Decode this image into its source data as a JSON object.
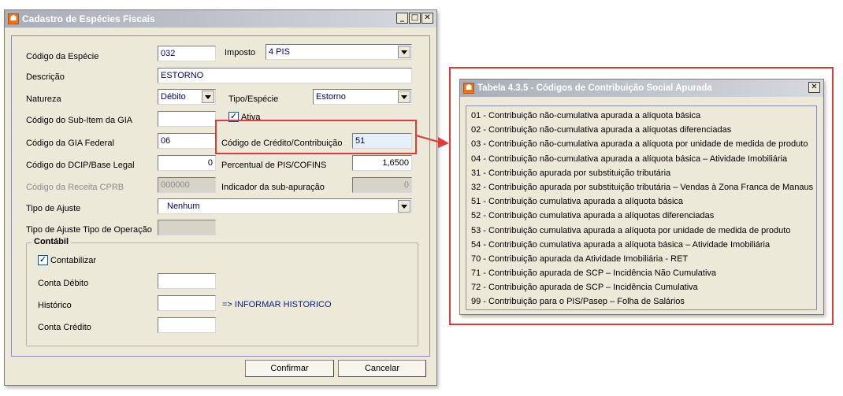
{
  "dialog": {
    "title": "Cadastro de Espécies Fiscais",
    "minimize_glyph": "_",
    "maximize_glyph": "□",
    "close_glyph": "✕",
    "fields": {
      "codigo_especie": {
        "label": "Código da Espécie",
        "value": "032"
      },
      "imposto": {
        "label": "Imposto",
        "value": "4 PIS"
      },
      "descricao": {
        "label": "Descrição",
        "value": "ESTORNO"
      },
      "natureza": {
        "label": "Natureza",
        "value": "Débito"
      },
      "tipo_especie": {
        "label": "Tipo/Espécie",
        "value": "Estorno"
      },
      "sub_item_gia": {
        "label": "Código do Sub-Item da GIA",
        "value": ""
      },
      "ativa": {
        "label": "Ativa",
        "checked": true
      },
      "gia_federal": {
        "label": "Código da GIA Federal",
        "value": "06"
      },
      "credito_contribuicao": {
        "label": "Código de Crédito/Contribuição",
        "value": "51"
      },
      "dcip": {
        "label": "Código do DCIP/Base Legal",
        "value": "0"
      },
      "percentual": {
        "label": "Percentual de PIS/COFINS",
        "value": "1,6500"
      },
      "receita_cprb": {
        "label": "Código da Receita CPRB",
        "value": "000000"
      },
      "sub_apuracao": {
        "label": "Indicador da sub-apuração",
        "value": "0"
      },
      "tipo_ajuste": {
        "label": "Tipo de Ajuste",
        "value": "Nenhum"
      },
      "tipo_ajuste_operacao": {
        "label": "Tipo de Ajuste Tipo de Operação",
        "value": ""
      }
    },
    "contabil": {
      "title": "Contábil",
      "contabilizar": {
        "label": "Contabilizar",
        "checked": true
      },
      "conta_debito": {
        "label": "Conta Débito",
        "value": ""
      },
      "historico": {
        "label": "Histórico",
        "value": ""
      },
      "informar_historico": "=> INFORMAR HISTORICO",
      "conta_credito": {
        "label": "Conta Crédito",
        "value": ""
      }
    },
    "buttons": {
      "confirmar": "Confirmar",
      "cancelar": "Cancelar"
    }
  },
  "popup": {
    "title": "Tabela 4.3.5 - Códigos de Contribuição Social Apurada",
    "close_glyph": "✕",
    "items": [
      "01 - Contribuição não-cumulativa apurada a alíquota básica",
      "02 - Contribuição não-cumulativa apurada a alíquotas diferenciadas",
      "03 - Contribuição não-cumulativa apurada a alíquota por unidade de medida de produto",
      "04 - Contribuição não-cumulativa apurada a alíquota básica – Atividade Imobiliária",
      "31 - Contribuição apurada por substituição tributária",
      "32 - Contribuição apurada por substituição tributária – Vendas à Zona Franca de Manaus",
      "51 - Contribuição cumulativa apurada a alíquota básica",
      "52 - Contribuição cumulativa apurada a alíquotas diferenciadas",
      "53 - Contribuição cumulativa apurada a alíquota por unidade de medida de produto",
      "54 - Contribuição cumulativa apurada a alíquota básica – Atividade Imobiliária",
      "70 - Contribuição apurada da Atividade Imobiliária - RET",
      "71 - Contribuição apurada de SCP – Incidência Não Cumulativa",
      "72 - Contribuição apurada de SCP – Incidência Cumulativa",
      "99 - Contribuição para o PIS/Pasep – Folha de Salários"
    ]
  },
  "colors": {
    "highlight": "#e03a3a",
    "field_text": "#00006e",
    "link": "#001d8e"
  }
}
